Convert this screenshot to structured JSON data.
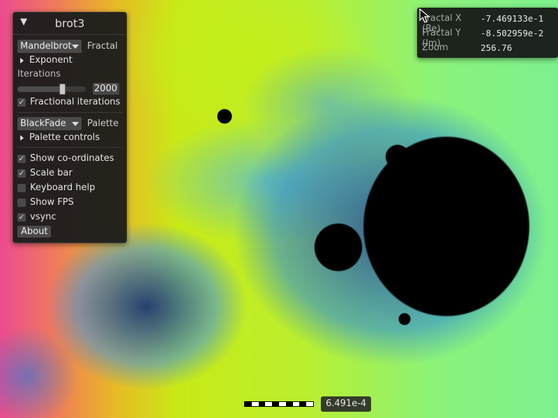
{
  "window": {
    "title": "brot3"
  },
  "fractal": {
    "selected": "Mandelbrot",
    "label": "Fractal"
  },
  "exponent": {
    "label": "Exponent"
  },
  "iterations": {
    "label": "Iterations",
    "value": "2000",
    "slider_fraction": 0.65
  },
  "fractional": {
    "label": "Fractional iterations",
    "checked": true
  },
  "palette": {
    "selected": "BlackFade",
    "label": "Palette",
    "controls_label": "Palette controls"
  },
  "options": {
    "show_coords": {
      "label": "Show co-ordinates",
      "checked": true
    },
    "scale_bar": {
      "label": "Scale bar",
      "checked": true
    },
    "keyboard_help": {
      "label": "Keyboard help",
      "checked": false
    },
    "show_fps": {
      "label": "Show FPS",
      "checked": false
    },
    "vsync": {
      "label": "vsync",
      "checked": true
    }
  },
  "about": {
    "label": "About"
  },
  "coords": {
    "x_label": "Fractal X (Re)",
    "x_value": "-7.469133e-1",
    "y_label": "Fractal Y (Im)",
    "y_value": "-8.502959e-2",
    "zoom_label": "Zoom",
    "zoom_value": "256.76"
  },
  "scale": {
    "value": "6.491e-4"
  },
  "check_mark": "✓",
  "icons": {
    "collapse": "▼"
  }
}
